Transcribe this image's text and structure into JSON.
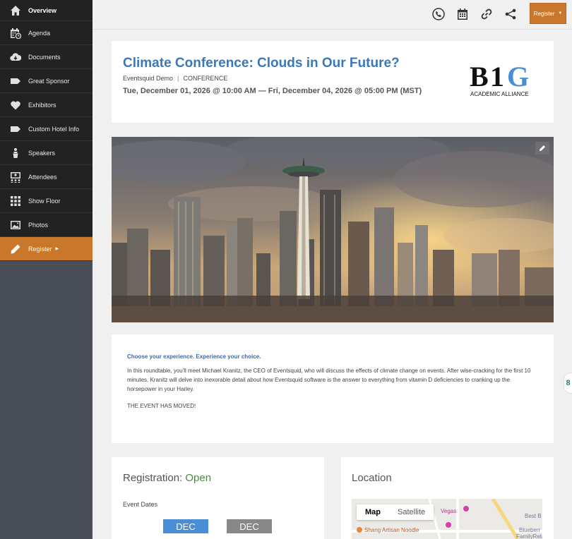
{
  "sidebar": {
    "items": [
      {
        "label": "Overview",
        "icon": "home-icon"
      },
      {
        "label": "Agenda",
        "icon": "calendar-clock-icon"
      },
      {
        "label": "Documents",
        "icon": "cloud-download-icon"
      },
      {
        "label": "Great Sponsor",
        "icon": "tag-icon"
      },
      {
        "label": "Exhibitors",
        "icon": "heart-icon"
      },
      {
        "label": "Custom Hotel Info",
        "icon": "tag-icon"
      },
      {
        "label": "Speakers",
        "icon": "speaker-podium-icon"
      },
      {
        "label": "Attendees",
        "icon": "attendees-icon"
      },
      {
        "label": "Show Floor",
        "icon": "grid-icon"
      },
      {
        "label": "Photos",
        "icon": "image-icon"
      },
      {
        "label": "Register",
        "icon": "pencil-icon"
      }
    ]
  },
  "topbar": {
    "register_label": "Register",
    "accent": "#c9782b"
  },
  "event": {
    "title": "Climate Conference: Clouds in Our Future?",
    "organizer": "Eventsquid Demo",
    "category": "CONFERENCE",
    "dates": "Tue, December 01, 2026 @ 10:00 AM — Fri, December 04, 2026 @ 05:00 PM (MST)",
    "logo_text": "B1G",
    "logo_subtitle": "ACADEMIC ALLIANCE"
  },
  "description": {
    "heading": "Choose your experience. Experience your choice.",
    "body": "In this roundtable, you'll meet Michael Kranitz, the CEO of Eventsquid, who will discuss the effects of climate change on events. After wise-cracking for the first 10 minutes, Kranitz will delve into inexorable detail about how Eventsquid software is the answer to everything from vitamin D deficiencies to cranking up the horsepower in your Harley.",
    "note": "THE EVENT HAS MOVED!"
  },
  "registration": {
    "label": "Registration:",
    "status": "Open",
    "dates_label": "Event Dates",
    "start_month": "DEC",
    "end_month": "DEC"
  },
  "location": {
    "title": "Location",
    "map_tab": "Map",
    "satellite_tab": "Satellite",
    "poi_1": "Shang Artisan Noodle",
    "poi_2": "Vegas",
    "poi_3": "Best B",
    "poi_4": "Blueberr",
    "poi_5": "FamilyReta"
  },
  "side_tab_label": "8"
}
